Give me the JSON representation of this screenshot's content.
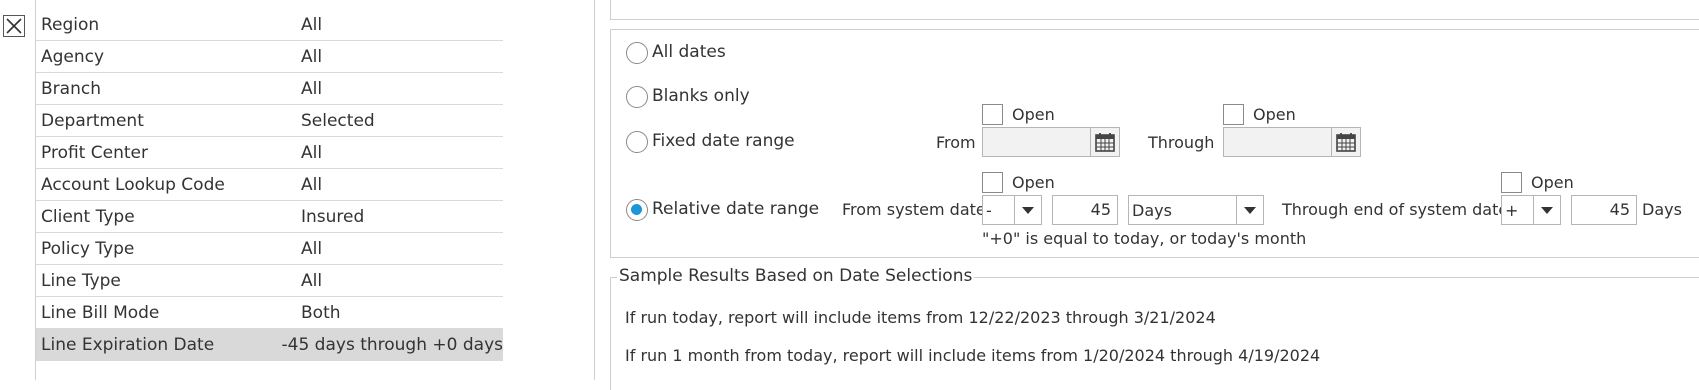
{
  "filters": [
    {
      "label": "Region",
      "value": "All",
      "selected": false
    },
    {
      "label": "Agency",
      "value": "All",
      "selected": false
    },
    {
      "label": "Branch",
      "value": "All",
      "selected": false
    },
    {
      "label": "Department",
      "value": "Selected",
      "selected": false
    },
    {
      "label": "Profit Center",
      "value": "All",
      "selected": false
    },
    {
      "label": "Account Lookup Code",
      "value": "All",
      "selected": false
    },
    {
      "label": "Client Type",
      "value": "Insured",
      "selected": false
    },
    {
      "label": "Policy Type",
      "value": "All",
      "selected": false
    },
    {
      "label": "Line Type",
      "value": "All",
      "selected": false
    },
    {
      "label": "Line Bill Mode",
      "value": "Both",
      "selected": false
    },
    {
      "label": "Line Expiration Date",
      "value": "-45 days through +0 days",
      "selected": true
    }
  ],
  "date_options": {
    "all_dates": "All dates",
    "blanks_only": "Blanks only",
    "fixed_range": "Fixed date range",
    "relative_range": "Relative date range",
    "selected": "relative_range"
  },
  "fixed": {
    "from_label": "From",
    "through_label": "Through",
    "open_label": "Open",
    "from_value": "",
    "through_value": ""
  },
  "relative": {
    "from_label": "From system date",
    "from_sign": "-",
    "from_amount": "45",
    "unit": "Days",
    "through_label": "Through end of system date",
    "through_sign": "+",
    "through_amount": "45",
    "through_unit": "Days",
    "open_label": "Open",
    "hint": "\"+0\" is equal to today, or today's month"
  },
  "sample": {
    "title": "Sample Results Based on Date Selections",
    "line1": "If run today, report will include items from 12/22/2023 through 3/21/2024",
    "line2": "If run 1 month from today, report will include items from 1/20/2024 through 4/19/2024"
  },
  "colors": {
    "radio_selected": "#1e96d6",
    "row_selected": "#d9d9d9"
  }
}
